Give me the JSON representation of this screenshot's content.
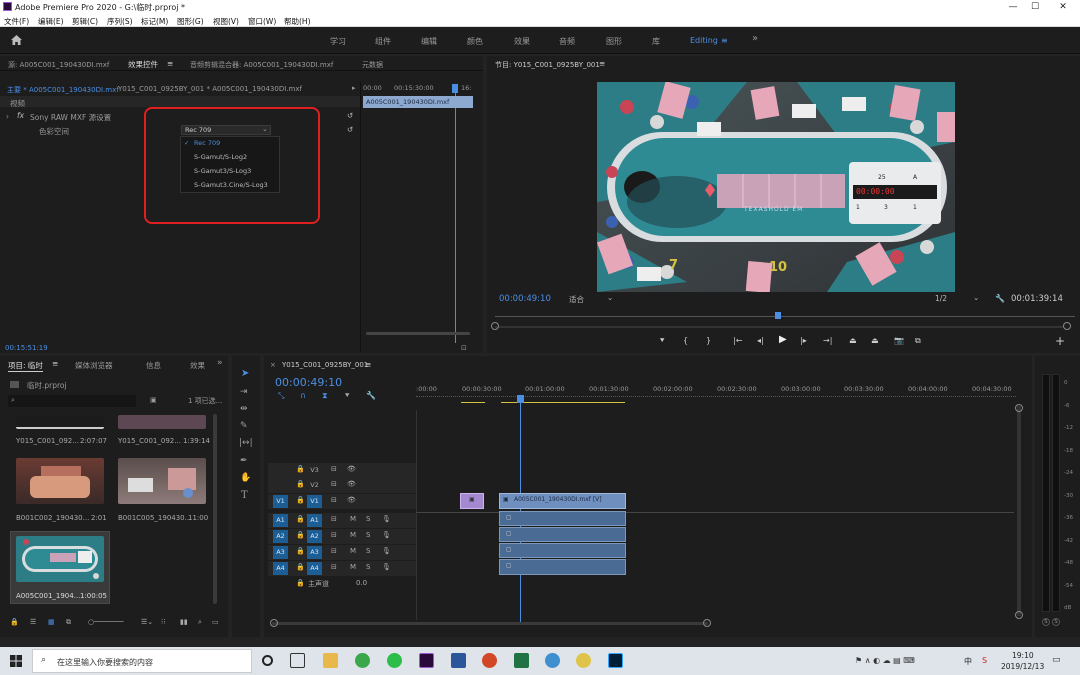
{
  "window": {
    "title": "Adobe Premiere Pro 2020 - G:\\临时.prproj *",
    "minimize": "—",
    "maximize": "☐",
    "close": "✕"
  },
  "menu": [
    "文件(F)",
    "编辑(E)",
    "剪辑(C)",
    "序列(S)",
    "标记(M)",
    "图形(G)",
    "视图(V)",
    "窗口(W)",
    "帮助(H)"
  ],
  "workspaces": {
    "home_icon": "home-icon",
    "tabs": [
      "学习",
      "组件",
      "编辑",
      "颜色",
      "效果",
      "音频",
      "图形",
      "库",
      "Editing"
    ],
    "active": "Editing",
    "menu_glyph": "≡",
    "more": "»"
  },
  "effect_controls": {
    "tabs": [
      "源: A005C001_190430DI.mxf",
      "效果控件",
      "音频剪辑混合器: A005C001_190430DI.mxf",
      "元数据"
    ],
    "tab_menu": "≡",
    "master_label": "主要 * A005C001_190430DI.mxf",
    "sequence_label": "Y015_C001_0925BY_001 * A005C001_190430DI.mxf",
    "section": "视频",
    "fx_label": "fx",
    "effect_name": "Sony RAW MXF 源设置",
    "property": "色彩空间",
    "dropdown_value": "Rec 709",
    "options": [
      "Rec 709",
      "S-Gamut/S-Log2",
      "S-Gamut3/S-Log3",
      "S-Gamut3.Cine/S-Log3"
    ],
    "checked": "Rec 709",
    "timecode": "00:15:51:19",
    "mini_ruler": [
      "00:00",
      "00:15:30:00",
      "16:"
    ],
    "mini_clip": "A005C001_190430DI.mxf"
  },
  "program_monitor": {
    "title": "节目: Y015_C001_0925BY_001",
    "menu": "≡",
    "timecode": "00:00:49:10",
    "fit": "适合",
    "fraction": "1/2",
    "duration": "00:01:39:14",
    "scene_logo": "TEXASHOLD'EM",
    "screen_time": "00:00:00",
    "numbers": [
      "7",
      "10"
    ],
    "card_vals": [
      "25",
      "A",
      "1",
      "3",
      "1"
    ],
    "controls": [
      "marker-icon",
      "mark-in-icon",
      "mark-out-icon",
      "goto-in-icon",
      "step-back-icon",
      "play-icon",
      "step-forward-icon",
      "goto-out-icon",
      "lift-icon",
      "extract-icon",
      "export-frame-icon",
      "compare-icon",
      "add-button-icon"
    ]
  },
  "project": {
    "tabs": [
      "项目: 临时",
      "媒体浏览器",
      "信息",
      "效果"
    ],
    "tab_menu": "≡",
    "more": "»",
    "file": "临时.prproj",
    "selected_info": "1 项已选...",
    "items": [
      {
        "name": "Y015_C001_092...",
        "duration": "2:07:07"
      },
      {
        "name": "Y015_C001_092...",
        "duration": "1:39:14"
      },
      {
        "name": "B001C002_190430...",
        "duration": "2:01"
      },
      {
        "name": "B001C005_190430...",
        "duration": "11:00"
      },
      {
        "name": "A005C001_1904...",
        "duration": "1:00:05"
      }
    ]
  },
  "tools": [
    "selection-icon",
    "track-select-icon",
    "ripple-edit-icon",
    "razor-icon",
    "slip-icon",
    "pen-icon",
    "hand-icon",
    "type-icon"
  ],
  "timeline": {
    "tab": "Y015_C001_0925BY_001",
    "tab_close": "×",
    "menu": "≡",
    "timecode": "00:00:49:10",
    "ruler": [
      ":00:00",
      "00:00:30:00",
      "00:01:00:00",
      "00:01:30:00",
      "00:02:00:00",
      "00:02:30:00",
      "00:03:00:00",
      "00:03:30:00",
      "00:04:00:00",
      "00:04:30:00"
    ],
    "video_tracks": [
      {
        "source": "",
        "name": "V3"
      },
      {
        "source": "",
        "name": "V2"
      },
      {
        "source": "V1",
        "name": "V1"
      }
    ],
    "audio_tracks": [
      {
        "source": "A1",
        "name": "A1"
      },
      {
        "source": "A2",
        "name": "A2"
      },
      {
        "source": "A3",
        "name": "A3"
      },
      {
        "source": "A4",
        "name": "A4"
      }
    ],
    "master": "主声道",
    "master_value": "0.0",
    "clip_label": "A005C001_190430DI.mxf [V]",
    "mute": "M",
    "solo": "S",
    "fx": "fx"
  },
  "audio_meter": {
    "scale": [
      "0",
      "-6",
      "-12",
      "-18",
      "-24",
      "-30",
      "-36",
      "-42",
      "-48",
      "-54",
      "dB"
    ],
    "solo_buttons": [
      "S",
      "S"
    ]
  },
  "taskbar": {
    "search_placeholder": "在这里输入你要搜索的内容",
    "time": "19:10",
    "date": "2019/12/13",
    "ime": "中",
    "apps": [
      "task-view-icon",
      "explorer-icon",
      "360-icon",
      "wechat-icon",
      "premiere-icon",
      "word-icon",
      "powerpoint-icon",
      "excel-icon",
      "app-icon",
      "chrome-icon",
      "photoshop-icon"
    ]
  },
  "colors": {
    "accent": "#4b8fe4",
    "panel": "#1d1d1d",
    "highlight_box": "#e02020",
    "playhead": "#4b8fe4"
  }
}
